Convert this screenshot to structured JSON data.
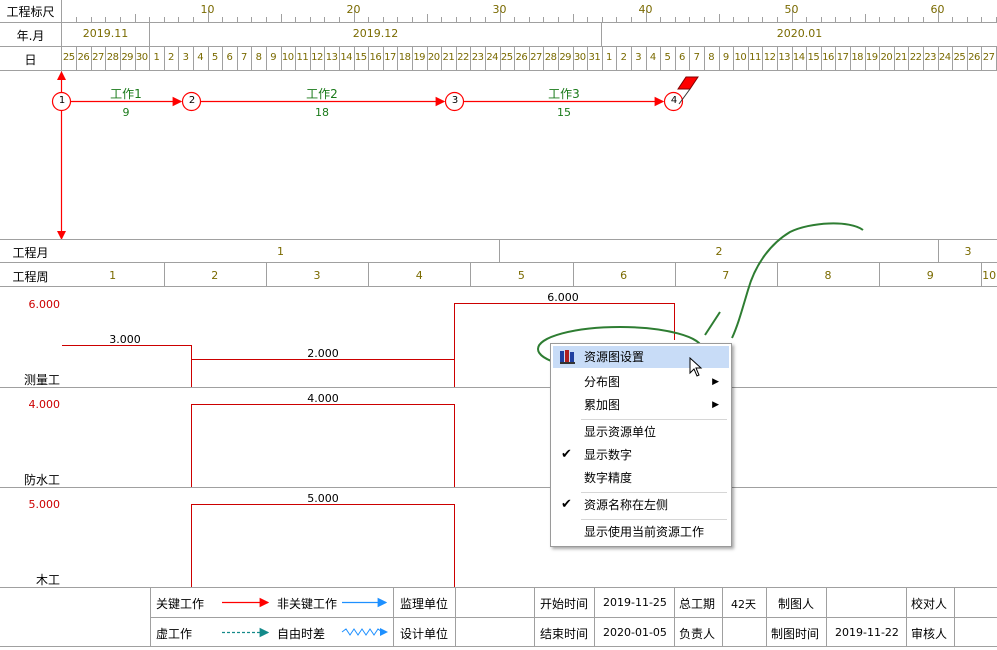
{
  "rows": {
    "ruler_label": "工程标尺",
    "ym_label": "年.月",
    "day_label": "日",
    "month_label": "工程月",
    "week_label": "工程周"
  },
  "ruler_ticks": [
    "10",
    "20",
    "30",
    "40",
    "50",
    "60"
  ],
  "months": [
    "2019.11",
    "2019.12",
    "2020.01"
  ],
  "days": [
    "25",
    "26",
    "27",
    "28",
    "29",
    "30",
    "1",
    "2",
    "3",
    "4",
    "5",
    "6",
    "7",
    "8",
    "9",
    "10",
    "11",
    "12",
    "13",
    "14",
    "15",
    "16",
    "17",
    "18",
    "19",
    "20",
    "21",
    "22",
    "23",
    "24",
    "25",
    "26",
    "27",
    "28",
    "29",
    "30",
    "31",
    "1",
    "2",
    "3",
    "4",
    "5",
    "6",
    "7",
    "8",
    "9",
    "10",
    "11",
    "12",
    "13",
    "14",
    "15",
    "16",
    "17",
    "18",
    "19",
    "20",
    "21",
    "22",
    "23",
    "24",
    "25",
    "26",
    "27"
  ],
  "project_months": [
    "1",
    "2",
    "3"
  ],
  "project_weeks": [
    "1",
    "2",
    "3",
    "4",
    "5",
    "6",
    "7",
    "8",
    "9",
    "10"
  ],
  "network": {
    "nodes": [
      "1",
      "2",
      "3",
      "4"
    ],
    "tasks": [
      {
        "name": "工作1",
        "duration": "9"
      },
      {
        "name": "工作2",
        "duration": "18"
      },
      {
        "name": "工作3",
        "duration": "15"
      }
    ]
  },
  "resources": [
    {
      "name": "测量工",
      "max": "6.000",
      "segments": [
        "3.000",
        "2.000",
        "6.000"
      ]
    },
    {
      "name": "防水工",
      "max": "4.000",
      "segments": [
        "4.000"
      ]
    },
    {
      "name": "木工",
      "max": "5.000",
      "segments": [
        "5.000"
      ]
    }
  ],
  "context_menu": {
    "items": [
      {
        "label": "资源图设置",
        "submenu": false,
        "checked": false
      },
      {
        "label": "分布图",
        "submenu": true,
        "checked": false
      },
      {
        "label": "累加图",
        "submenu": true,
        "checked": false
      },
      {
        "label": "显示资源单位",
        "submenu": false,
        "checked": false
      },
      {
        "label": "显示数字",
        "submenu": false,
        "checked": true
      },
      {
        "label": "数字精度",
        "submenu": false,
        "checked": false
      },
      {
        "label": "资源名称在左侧",
        "submenu": false,
        "checked": true
      },
      {
        "label": "显示使用当前资源工作",
        "submenu": false,
        "checked": false
      }
    ]
  },
  "legend": {
    "critical_work": "关键工作",
    "non_critical_work": "非关键工作",
    "dummy_work": "虚工作",
    "free_float": "自由时差",
    "supervision_unit": "监理单位",
    "design_unit": "设计单位"
  },
  "info": {
    "start_label": "开始时间",
    "start_value": "2019-11-25",
    "end_label": "结束时间",
    "end_value": "2020-01-05",
    "duration_label": "总工期",
    "duration_value": "42天",
    "owner_label": "负责人",
    "drafter_label": "制图人",
    "draw_time_label": "制图时间",
    "draw_time_value": "2019-11-22",
    "checker_label": "校对人",
    "reviewer_label": "审核人"
  },
  "colors": {
    "critical": "#ff0000",
    "non_critical": "#1e90ff",
    "resource_line": "#cc0000",
    "label_olive": "#7a6a00",
    "task_green": "#1a7a1a",
    "annotation_green": "#2e7d32",
    "menu_highlight": "#c8dcf7"
  }
}
